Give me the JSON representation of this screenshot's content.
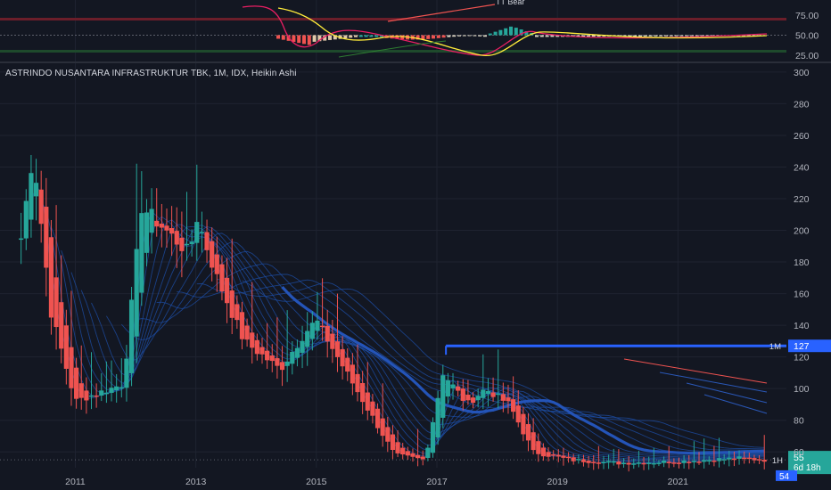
{
  "chart_title": "ASTRINDO NUSANTARA INFRASTRUKTUR TBK, 1M, IDX, Heikin Ashi",
  "colors": {
    "background": "#131722",
    "up": "#26a69a",
    "down": "#ef5350",
    "ribbon": "#1e4fa8",
    "level_line": "#2962ff",
    "text": "#b2b5be"
  },
  "oscillator": {
    "ticks": [
      "75.00",
      "50.00",
      "25.00"
    ],
    "tick_values": [
      75,
      50,
      25
    ],
    "annotation": "TT Bear",
    "upper_band": 70,
    "lower_band": 30
  },
  "chart_data": {
    "type": "candlestick",
    "style": "Heikin Ashi",
    "interval": "1M",
    "exchange": "IDX",
    "y_ticks": [
      300,
      280,
      260,
      240,
      220,
      200,
      180,
      160,
      140,
      120,
      100,
      80,
      60
    ],
    "x_ticks": [
      "2011",
      "2013",
      "2015",
      "2017",
      "2019",
      "2021"
    ],
    "x_tick_years": [
      2011,
      2013,
      2015,
      2017,
      2019,
      2021
    ],
    "ylim": [
      50,
      305
    ],
    "xlim": [
      2009.75,
      2022.8
    ],
    "grid": true,
    "resistance": {
      "label": "1M",
      "value": 127,
      "text": "127",
      "from_year": 2017.15
    },
    "current_level": {
      "label": "1H",
      "value": 55,
      "text": "55",
      "countdown": "6d 18h"
    },
    "low_level": {
      "value": 54,
      "text": "54"
    },
    "key_points": [
      {
        "t": 2010.1,
        "v": 195
      },
      {
        "t": 2010.3,
        "v": 250
      },
      {
        "t": 2010.6,
        "v": 148
      },
      {
        "t": 2011.0,
        "v": 92
      },
      {
        "t": 2011.8,
        "v": 103
      },
      {
        "t": 2012.1,
        "v": 215
      },
      {
        "t": 2012.5,
        "v": 200
      },
      {
        "t": 2012.9,
        "v": 185
      },
      {
        "t": 2013.0,
        "v": 210
      },
      {
        "t": 2013.35,
        "v": 170
      },
      {
        "t": 2013.8,
        "v": 130
      },
      {
        "t": 2014.4,
        "v": 112
      },
      {
        "t": 2014.8,
        "v": 135
      },
      {
        "t": 2015.0,
        "v": 143
      },
      {
        "t": 2015.5,
        "v": 110
      },
      {
        "t": 2016.3,
        "v": 58
      },
      {
        "t": 2016.8,
        "v": 55
      },
      {
        "t": 2017.1,
        "v": 110
      },
      {
        "t": 2017.5,
        "v": 90
      },
      {
        "t": 2017.8,
        "v": 100
      },
      {
        "t": 2018.2,
        "v": 90
      },
      {
        "t": 2018.6,
        "v": 60
      },
      {
        "t": 2019.2,
        "v": 55
      },
      {
        "t": 2020.0,
        "v": 53
      },
      {
        "t": 2021.0,
        "v": 54
      },
      {
        "t": 2022.0,
        "v": 56
      },
      {
        "t": 2022.4,
        "v": 55
      }
    ]
  }
}
